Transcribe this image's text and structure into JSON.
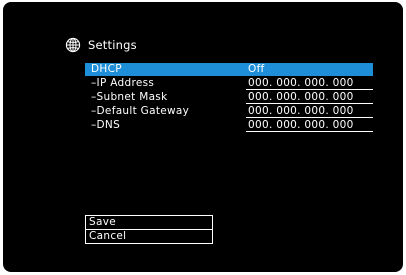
{
  "header": {
    "icon": "globe-icon",
    "title": "Settings"
  },
  "rows": [
    {
      "label": "DHCP",
      "value": "Off",
      "selected": true
    },
    {
      "label": "–IP Address",
      "value": "000. 000. 000. 000"
    },
    {
      "label": "–Subnet Mask",
      "value": "000. 000. 000. 000"
    },
    {
      "label": "–Default Gateway",
      "value": "000. 000. 000. 000"
    },
    {
      "label": "–DNS",
      "value": "000. 000. 000. 000"
    }
  ],
  "buttons": {
    "save": "Save",
    "cancel": "Cancel"
  },
  "colors": {
    "background": "#000000",
    "highlight": "#1e8ed8",
    "text": "#ffffff"
  }
}
